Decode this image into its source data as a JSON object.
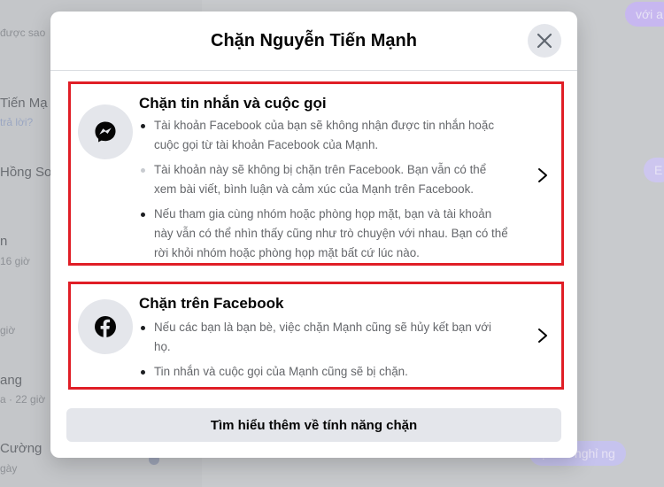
{
  "background": {
    "left_items": [
      "được sao",
      "Tiến Mạ",
      "trả lời?",
      "Hồng So",
      "n",
      "16 giờ",
      "giờ",
      "ang",
      "a · 22 giờ",
      "Cường",
      "gày"
    ],
    "bubbles": [
      "với a",
      "E",
      "ọn rồi nghỉ ng"
    ]
  },
  "dialog": {
    "title": "Chặn Nguyễn Tiến Mạnh",
    "close_icon": "close-icon",
    "options": [
      {
        "icon": "messenger-icon",
        "title": "Chặn tin nhắn và cuộc gọi",
        "bullets": [
          "Tài khoản Facebook của bạn sẽ không nhận được tin nhắn hoặc cuộc gọi từ tài khoản Facebook của Mạnh.",
          "Tài khoản này sẽ không bị chặn trên Facebook. Bạn vẫn có thể xem bài viết, bình luận và cảm xúc của Mạnh trên Facebook.",
          "Nếu tham gia cùng nhóm hoặc phòng họp mặt, bạn và tài khoản này vẫn có thể nhìn thấy cũng như trò chuyện với nhau. Bạn có thể rời khỏi nhóm hoặc phòng họp mặt bất cứ lúc nào."
        ]
      },
      {
        "icon": "facebook-icon",
        "title": "Chặn trên Facebook",
        "bullets": [
          "Nếu các bạn là bạn bè, việc chặn Mạnh cũng sẽ hủy kết bạn với họ.",
          "Tin nhắn và cuộc gọi của Mạnh cũng sẽ bị chặn."
        ]
      }
    ],
    "learn_more": "Tìm hiểu thêm về tính năng chặn"
  },
  "colors": {
    "highlight_border": "#e01e26",
    "icon_bg": "#e4e6eb",
    "secondary_text": "#65676b"
  }
}
